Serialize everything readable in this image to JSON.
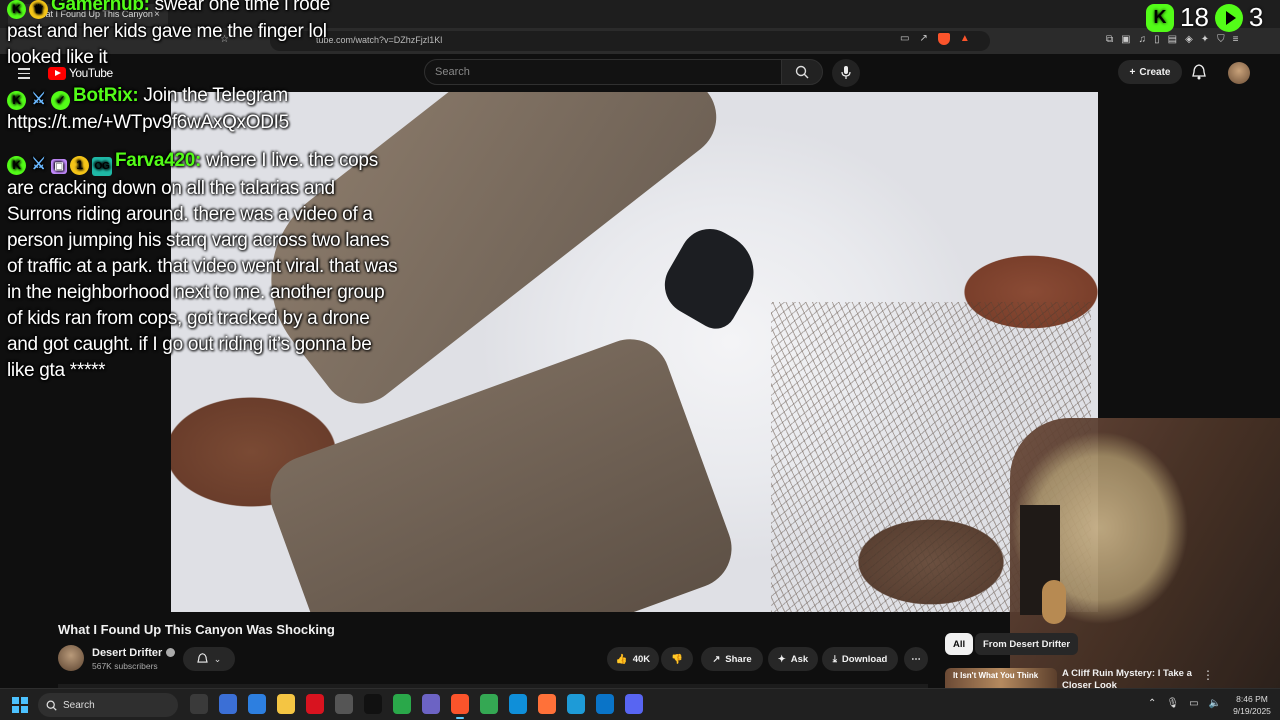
{
  "browser": {
    "tab_title": "What I Found Up This Canyon",
    "tab_close": "×",
    "url": "tube.com/watch?v=DZhzFjzl1Kl"
  },
  "youtube": {
    "logo_text": "YouTube",
    "search_placeholder": "Search",
    "create_label": "Create"
  },
  "stream_counters": {
    "viewers": "18",
    "second_count": "3",
    "kick_glyph": "K"
  },
  "chat": {
    "messages": [
      {
        "username": "Gamernub:",
        "username_color": "#53fc18",
        "text": " swear one time i rode past and her kids gave me the finger lol looked like it"
      },
      {
        "username": "BotRix:",
        "username_color": "#53fc18",
        "text": " Join the Telegram https://t.me/+WTpv9f6wAxQxODI5"
      },
      {
        "username": "Farva420:",
        "username_color": "#53fc18",
        "text": " where I live. the cops are cracking down on all the talarias and Surrons riding around. there was a video of a person jumping his starq varg across two lanes of traffic at a park. that video went viral. that was in the neighborhood next to me. another group of kids ran from cops, got tracked by a drone and got caught. if I go out riding it’s gonna be like gta *****"
      }
    ]
  },
  "video": {
    "title": "What I Found Up This Canyon Was Shocking",
    "channel_name": "Desert Drifter",
    "subscribers": "567K subscribers",
    "likes": "40K",
    "share_label": "Share",
    "ask_label": "Ask",
    "download_label": "Download",
    "more_label": "⋯"
  },
  "recommendations": {
    "chips": [
      "All",
      "From Desert Drifter"
    ],
    "first_thumb_text": "It Isn't What You Think",
    "first_title": "A Cliff Ruin Mystery: I Take a Closer Look"
  },
  "taskbar": {
    "search_label": "Search",
    "time": "8:46 PM",
    "date": "9/19/2025",
    "apps": [
      {
        "name": "task-view",
        "color": "#3a3a3a"
      },
      {
        "name": "app-blue",
        "color": "#3b6fd6"
      },
      {
        "name": "app-r",
        "color": "#2d7fe0"
      },
      {
        "name": "file-explorer",
        "color": "#f4c543"
      },
      {
        "name": "netflix",
        "color": "#d8131f"
      },
      {
        "name": "app-clock",
        "color": "#555555"
      },
      {
        "name": "capcut",
        "color": "#111111"
      },
      {
        "name": "app-green",
        "color": "#2aa84a"
      },
      {
        "name": "discord-app",
        "color": "#6c63c4"
      },
      {
        "name": "brave",
        "color": "#fb542b"
      },
      {
        "name": "chrome",
        "color": "#34a853"
      },
      {
        "name": "edge",
        "color": "#0f8fd9"
      },
      {
        "name": "firefox",
        "color": "#ff7139"
      },
      {
        "name": "app-loop",
        "color": "#1e9bd7"
      },
      {
        "name": "vscode",
        "color": "#0a74c8"
      },
      {
        "name": "discord",
        "color": "#5865f2"
      }
    ]
  },
  "colors": {
    "kick_green": "#53fc18",
    "youtube_red": "#ff0000",
    "brave_orange": "#fb542b"
  }
}
